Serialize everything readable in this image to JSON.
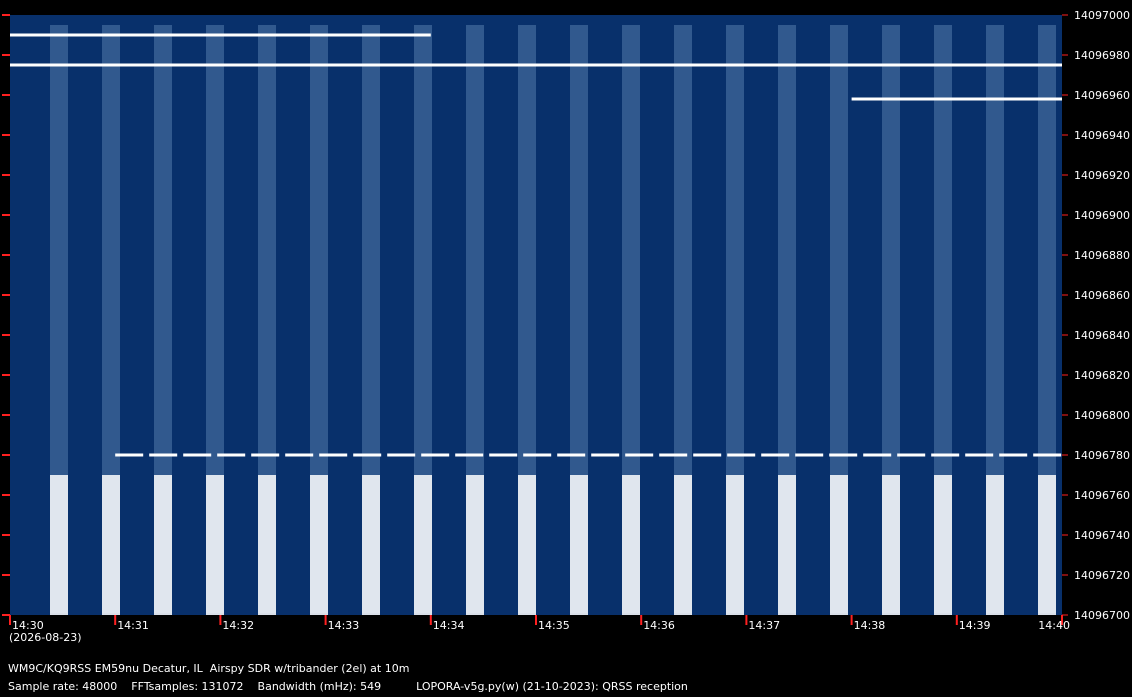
{
  "chart_data": {
    "type": "heatmap",
    "title": "",
    "xlabel": "",
    "ylabel": "",
    "x_ticks": [
      "14:30",
      "14:31",
      "14:32",
      "14:33",
      "14:34",
      "14:35",
      "14:36",
      "14:37",
      "14:38",
      "14:39",
      "14:40"
    ],
    "y_ticks": [
      14097000,
      14096980,
      14096960,
      14096940,
      14096920,
      14096900,
      14096880,
      14096860,
      14096840,
      14096820,
      14096800,
      14096780,
      14096760,
      14096740,
      14096720,
      14096700
    ],
    "xlim": [
      "14:30",
      "14:40"
    ],
    "ylim": [
      14096700,
      14097000
    ],
    "date": "(2026-08-23)",
    "colors": {
      "background": "#08306b",
      "signal": "#ffffff",
      "tick": "#ff2020",
      "text": "#ffffff"
    },
    "signals": [
      {
        "freq": 14096780,
        "start": "14:31",
        "end": "14:40",
        "style": "dashed-carrier"
      },
      {
        "freq": 14096975,
        "start": "14:30",
        "end": "14:40",
        "style": "carrier"
      },
      {
        "freq": 14096990,
        "start": "14:30",
        "end": "14:34",
        "style": "carrier"
      },
      {
        "freq": 14096958,
        "start": "14:38",
        "end": "14:40",
        "style": "carrier"
      }
    ]
  },
  "info": {
    "line1": "WM9C/KQ9RSS EM59nu Decatur, IL  Airspy SDR w/tribander (2el) at 10m",
    "line2": "Sample rate: 48000    FFTsamples: 131072    Bandwidth (mHz): 549          LOPORA-v5g.py(w) (21-10-2023): QRSS reception"
  }
}
